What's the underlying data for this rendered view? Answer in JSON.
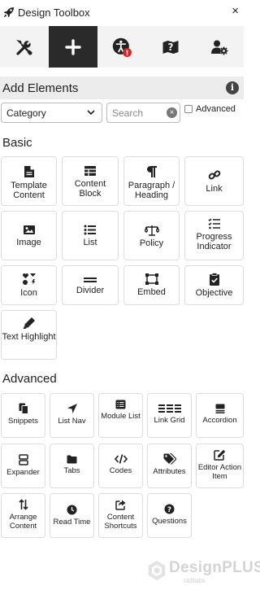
{
  "window": {
    "title": "Design Toolbox",
    "close_glyph": "×"
  },
  "toolbar": [
    {
      "name": "tools",
      "icon": "wrench-screwdriver-icon",
      "active": false
    },
    {
      "name": "add",
      "icon": "plus-icon",
      "active": true
    },
    {
      "name": "accessibility",
      "icon": "accessibility-warning-icon",
      "badge": "!",
      "badge_color": "#e02020"
    },
    {
      "name": "help",
      "icon": "question-map-icon"
    },
    {
      "name": "settings",
      "icon": "user-gear-icon"
    }
  ],
  "section": {
    "title": "Add Elements",
    "info_glyph": "i"
  },
  "filters": {
    "category": {
      "selected": "Category"
    },
    "search": {
      "placeholder": "Search",
      "clear_glyph": "×"
    },
    "advanced": {
      "label": "Advanced",
      "checked": false
    }
  },
  "groups": {
    "basic": {
      "heading": "Basic",
      "items": [
        {
          "label": "Template Content",
          "icon": "document-icon"
        },
        {
          "label": "Content Block",
          "icon": "table-grid-icon"
        },
        {
          "label": "Paragraph / Heading",
          "icon": "pilcrow-icon"
        },
        {
          "label": "Link",
          "icon": "link-icon"
        },
        {
          "label": "Image",
          "icon": "image-icon"
        },
        {
          "label": "List",
          "icon": "list-icon"
        },
        {
          "label": "Policy",
          "icon": "scale-icon"
        },
        {
          "label": "Progress Indicator",
          "icon": "checklist-icon"
        },
        {
          "label": "Icon",
          "icon": "icons-icon"
        },
        {
          "label": "Divider",
          "icon": "divider-icon"
        },
        {
          "label": "Embed",
          "icon": "embed-frame-icon"
        },
        {
          "label": "Objective",
          "icon": "clipboard-check-icon"
        },
        {
          "label": "Text Highlight",
          "icon": "highlighter-icon"
        }
      ]
    },
    "advanced": {
      "heading": "Advanced",
      "items": [
        {
          "label": "Snippets",
          "icon": "copy-icon"
        },
        {
          "label": "List Nav",
          "icon": "location-arrow-icon"
        },
        {
          "label": "Module List",
          "icon": "module-list-icon"
        },
        {
          "label": "Link Grid",
          "icon": "link-grid-icon"
        },
        {
          "label": "Accordion",
          "icon": "accordion-icon"
        },
        {
          "label": "Expander",
          "icon": "expander-icon"
        },
        {
          "label": "Tabs",
          "icon": "folder-icon"
        },
        {
          "label": "Codes",
          "icon": "code-icon"
        },
        {
          "label": "Attributes",
          "icon": "tags-icon"
        },
        {
          "label": "Editor Action Item",
          "icon": "edit-icon"
        },
        {
          "label": "Arrange Content",
          "icon": "arrange-arrows-icon"
        },
        {
          "label": "Read Time",
          "icon": "clock-icon"
        },
        {
          "label": "Content Shortcuts",
          "icon": "share-square-icon"
        },
        {
          "label": "Questions",
          "icon": "question-circle-icon"
        }
      ]
    }
  },
  "brand": {
    "name": "DesignPLUS",
    "sub": "cidilabs"
  }
}
